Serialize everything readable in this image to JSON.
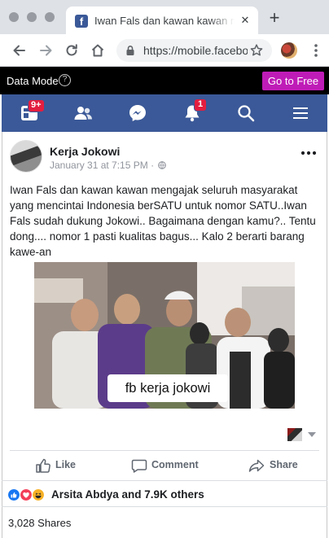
{
  "browser": {
    "tab": {
      "title": "Iwan Fals dan kawan kawan mengajak",
      "favicon": "f",
      "close": "✕"
    },
    "new_tab": "+",
    "url": "https://mobile.facebook.com",
    "icons": {
      "back": "back-arrow-icon",
      "forward": "forward-arrow-icon",
      "reload": "reload-icon",
      "home": "home-icon",
      "lock": "lock-icon",
      "bookmark": "star-icon",
      "extension": "extension-avatar-icon",
      "menu": "vertical-dots-icon"
    }
  },
  "data_mode_bar": {
    "label": "Data Mode",
    "help": "?",
    "button": "Go to Free",
    "button_color": "#bf1cb7"
  },
  "fb_nav": {
    "brand_color": "#3b5998",
    "items": [
      {
        "icon": "news-feed-icon",
        "badge": "9+"
      },
      {
        "icon": "friends-icon",
        "badge": ""
      },
      {
        "icon": "messenger-icon",
        "badge": ""
      },
      {
        "icon": "notifications-bell-icon",
        "badge": "1"
      },
      {
        "icon": "search-icon",
        "badge": ""
      },
      {
        "icon": "hamburger-menu-icon",
        "badge": ""
      }
    ]
  },
  "post": {
    "author": "Kerja Jokowi",
    "timestamp": "January 31 at 7:15 PM · ",
    "privacy_icon": "globe-icon",
    "more": "more-options-icon",
    "text": "Iwan Fals dan kawan kawan mengajak seluruh masyarakat yang mencintai Indonesia berSATU untuk nomor SATU..Iwan Fals sudah dukung Jokowi.. Bagaimana dengan kamu?.. Tentu dong.... nomor 1 pasti kualitas bagus... Kalo 2 berarti barang kawe-an",
    "photo_caption": "fb kerja jokowi",
    "actions": {
      "like": "Like",
      "comment": "Comment",
      "share": "Share"
    },
    "reactions": {
      "types": [
        "like",
        "love",
        "haha"
      ],
      "summary": "Arsita Abdya and 7.9K others"
    },
    "shares": "3,028 Shares"
  }
}
